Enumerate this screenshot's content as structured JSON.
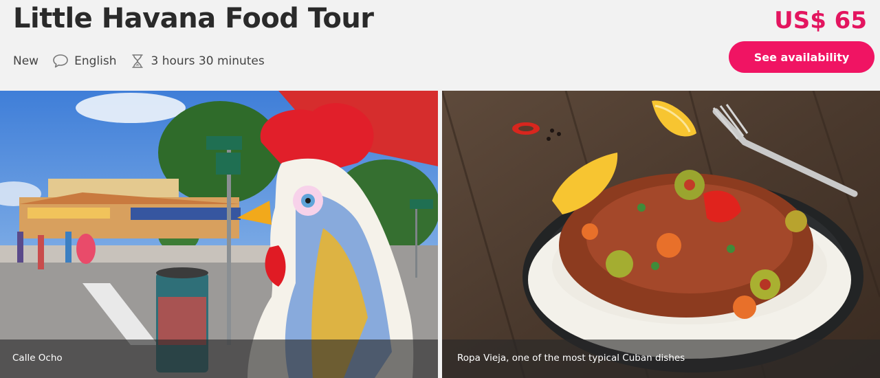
{
  "tour": {
    "title": "Little Havana Food Tour",
    "badge": "New",
    "language": "English",
    "duration": "3 hours 30 minutes"
  },
  "pricing": {
    "price": "US$ 65",
    "cta_label": "See availability"
  },
  "icons": {
    "language": "speech-bubble-icon",
    "duration": "hourglass-icon"
  },
  "gallery": {
    "photos": [
      {
        "caption": "Calle Ocho"
      },
      {
        "caption": "Ropa Vieja, one of the most typical Cuban dishes"
      }
    ]
  },
  "colors": {
    "accent": "#f01463",
    "price": "#e3155f",
    "background": "#f2f2f2"
  }
}
